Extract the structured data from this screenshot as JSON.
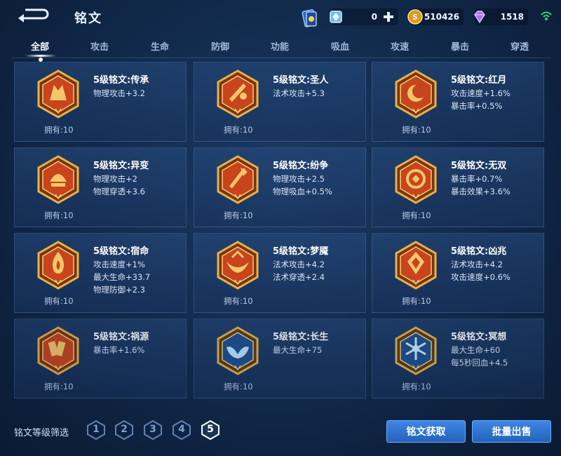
{
  "header": {
    "title": "铭文",
    "resources": [
      {
        "icon": "diamond-icon",
        "value": "0"
      },
      {
        "icon": "gold-coin-icon",
        "value": "510426"
      },
      {
        "icon": "gem-icon",
        "value": "1518"
      }
    ]
  },
  "tabs": [
    "全部",
    "攻击",
    "生命",
    "防御",
    "功能",
    "吸血",
    "攻速",
    "暴击",
    "穿透"
  ],
  "active_tab": "全部",
  "runes": [
    {
      "name": "5级铭文:传承",
      "stats": [
        "物理攻击+3.2"
      ],
      "owned": "拥有:10",
      "theme": "red",
      "icon": "rune-chuancheng-icon"
    },
    {
      "name": "5级铭文:圣人",
      "stats": [
        "法术攻击+5.3"
      ],
      "owned": "拥有:10",
      "theme": "red",
      "icon": "rune-shengren-icon"
    },
    {
      "name": "5级铭文:红月",
      "stats": [
        "攻击速度+1.6%",
        "暴击率+0.5%"
      ],
      "owned": "拥有:10",
      "theme": "red",
      "icon": "rune-hongyue-icon"
    },
    {
      "name": "5级铭文:异变",
      "stats": [
        "物理攻击+2",
        "物理穿透+3.6"
      ],
      "owned": "拥有:10",
      "theme": "red",
      "icon": "rune-yibian-icon"
    },
    {
      "name": "5级铭文:纷争",
      "stats": [
        "物理攻击+2.5",
        "物理吸血+0.5%"
      ],
      "owned": "拥有:10",
      "theme": "red",
      "icon": "rune-fenzheng-icon"
    },
    {
      "name": "5级铭文:无双",
      "stats": [
        "暴击率+0.7%",
        "暴击效果+3.6%"
      ],
      "owned": "拥有:10",
      "theme": "red",
      "icon": "rune-wushuang-icon"
    },
    {
      "name": "5级铭文:宿命",
      "stats": [
        "攻击速度+1%",
        "最大生命+33.7",
        "物理防御+2.3"
      ],
      "owned": "拥有:10",
      "theme": "red",
      "icon": "rune-suming-icon"
    },
    {
      "name": "5级铭文:梦魇",
      "stats": [
        "法术攻击+4.2",
        "法术穿透+2.4"
      ],
      "owned": "拥有:10",
      "theme": "red",
      "icon": "rune-mengyan-icon"
    },
    {
      "name": "5级铭文:凶兆",
      "stats": [
        "法术攻击+4.2",
        "攻击速度+0.6%"
      ],
      "owned": "拥有:10",
      "theme": "red",
      "icon": "rune-xiongzhao-icon"
    },
    {
      "name": "5级铭文:祸源",
      "stats": [
        "暴击率+1.6%"
      ],
      "owned": "拥有:10",
      "theme": "red",
      "icon": "rune-huoyuan-icon"
    },
    {
      "name": "5级铭文:长生",
      "stats": [
        "最大生命+75"
      ],
      "owned": "拥有:10",
      "theme": "blue",
      "icon": "rune-changsheng-icon"
    },
    {
      "name": "5级铭文:冥想",
      "stats": [
        "最大生命+60",
        "每5秒回血+4.5"
      ],
      "owned": "拥有:10",
      "theme": "blue",
      "icon": "rune-mingxiang-icon"
    }
  ],
  "footer": {
    "filter_label": "铭文等级筛选",
    "levels": [
      "1",
      "2",
      "3",
      "4",
      "5"
    ],
    "active_level": "5",
    "obtain_button": "铭文获取",
    "sell_button": "批量出售"
  }
}
